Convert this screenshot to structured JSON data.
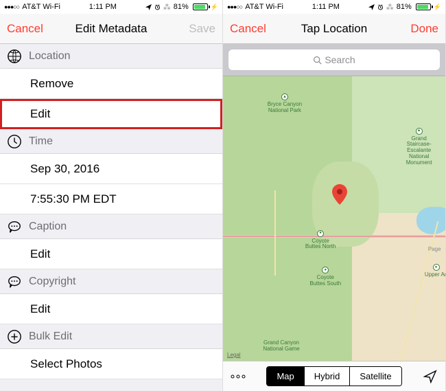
{
  "status": {
    "carrier": "AT&T Wi-Fi",
    "time": "1:11 PM",
    "battery_pct": "81%"
  },
  "left": {
    "nav": {
      "left": "Cancel",
      "title": "Edit Metadata",
      "right": "Save"
    },
    "sections": {
      "location": {
        "header": "Location",
        "rows": [
          "Remove",
          "Edit"
        ]
      },
      "time": {
        "header": "Time",
        "rows": [
          "Sep 30, 2016",
          "7:55:30 PM EDT"
        ]
      },
      "caption": {
        "header": "Caption",
        "rows": [
          "Edit"
        ]
      },
      "copyright": {
        "header": "Copyright",
        "rows": [
          "Edit"
        ]
      },
      "bulk": {
        "header": "Bulk Edit",
        "rows": [
          "Select Photos"
        ]
      }
    }
  },
  "right": {
    "nav": {
      "left": "Cancel",
      "title": "Tap Location",
      "right": "Done"
    },
    "search_placeholder": "Search",
    "map_labels": {
      "bryce": "Bryce Canyon\nNational Park",
      "staircase": "Grand\nStaircase-\nEscalante\nNational\nMonument",
      "buttes_n": "Coyote\nButtes North",
      "buttes_s": "Coyote\nButtes South",
      "page": "Page",
      "upper": "Upper An",
      "canyon": "Grand Canyon\nNational Game",
      "legal": "Legal"
    },
    "toolbar": {
      "map": "Map",
      "hybrid": "Hybrid",
      "satellite": "Satellite"
    }
  }
}
